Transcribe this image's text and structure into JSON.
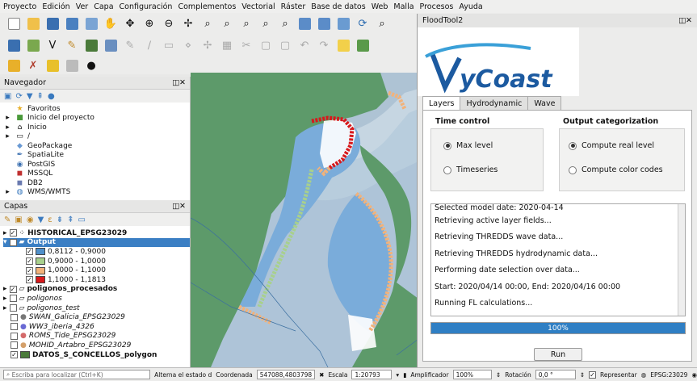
{
  "menu": [
    "Proyecto",
    "Edición",
    "Ver",
    "Capa",
    "Configuración",
    "Complementos",
    "Vectorial",
    "Ráster",
    "Base de datos",
    "Web",
    "Malla",
    "Procesos",
    "Ayuda"
  ],
  "navigator": {
    "title": "Navegador",
    "items": [
      "Favoritos",
      "Inicio del proyecto",
      "Inicio",
      "/",
      "GeoPackage",
      "SpatiaLite",
      "PostGIS",
      "MSSQL",
      "DB2",
      "WMS/WMTS"
    ]
  },
  "layers": {
    "title": "Capas",
    "items": [
      {
        "label": "HISTORICAL_EPSG23029",
        "checked": true,
        "style": "bold"
      },
      {
        "label": "Output",
        "checked": true,
        "style": "bold-selected"
      },
      {
        "label": "0,8112 - 0,9000",
        "checked": true,
        "color": "#4f8fc9"
      },
      {
        "label": "0,9000 - 1,0000",
        "checked": true,
        "color": "#a8d08d"
      },
      {
        "label": "1,0000 - 1,1000",
        "checked": true,
        "color": "#f2b27a"
      },
      {
        "label": "1,1000 - 1,1813",
        "checked": true,
        "color": "#d7191c"
      },
      {
        "label": "poligonos_procesados",
        "checked": true,
        "style": "bold"
      },
      {
        "label": "poligonos",
        "checked": false,
        "style": "italic"
      },
      {
        "label": "poligonos_test",
        "checked": false,
        "style": "italic"
      },
      {
        "label": "SWAN_Galicia_EPSG23029",
        "checked": false,
        "style": "italic"
      },
      {
        "label": "WW3_iberia_4326",
        "checked": false,
        "style": "italic"
      },
      {
        "label": "ROMS_Tide_EPSG23029",
        "checked": false,
        "style": "italic"
      },
      {
        "label": "MOHID_Artabro_EPSG23029",
        "checked": false,
        "style": "italic"
      },
      {
        "label": "DATOS_S_CONCELLOS_polygon",
        "checked": true,
        "style": "bold"
      }
    ]
  },
  "statusbar": {
    "search_placeholder": "Escriba para localizar (Ctrl+K)",
    "toggle_label": "Alterna el estado d",
    "coord_label": "Coordenada",
    "coord_value": "547088,4803798",
    "scale_label": "Escala",
    "scale_value": "1:20793",
    "magnifier_label": "Amplificador",
    "magnifier_value": "100%",
    "rotation_label": "Rotación",
    "rotation_value": "0,0 °",
    "render_label": "Representar",
    "crs": "EPSG:23029"
  },
  "dialog": {
    "title": "FloodTool2",
    "logo_text": "MyCoast",
    "tabs": [
      "Layers",
      "Hydrodynamic",
      "Wave"
    ],
    "time_control": {
      "title": "Time control",
      "options": [
        "Max level",
        "Timeseries"
      ],
      "selected": "Max level"
    },
    "output": {
      "title": "Output categorization",
      "options": [
        "Compute real level",
        "Compute color codes"
      ],
      "selected": "Compute real level"
    },
    "log": [
      "Selected model date: 2020-04-14",
      "Retrieving active layer fields...",
      "Retrieving THREDDS wave data...",
      "Retrieving THREDDS hydrodynamic data...",
      "Performing date selection over data...",
      "Start: 2020/04/14 00:00, End: 2020/04/16 00:00",
      "Running FL calculations..."
    ],
    "progress": {
      "value": 100,
      "text": "100%"
    },
    "run_label": "Run",
    "accent": "#2f7fc4"
  }
}
